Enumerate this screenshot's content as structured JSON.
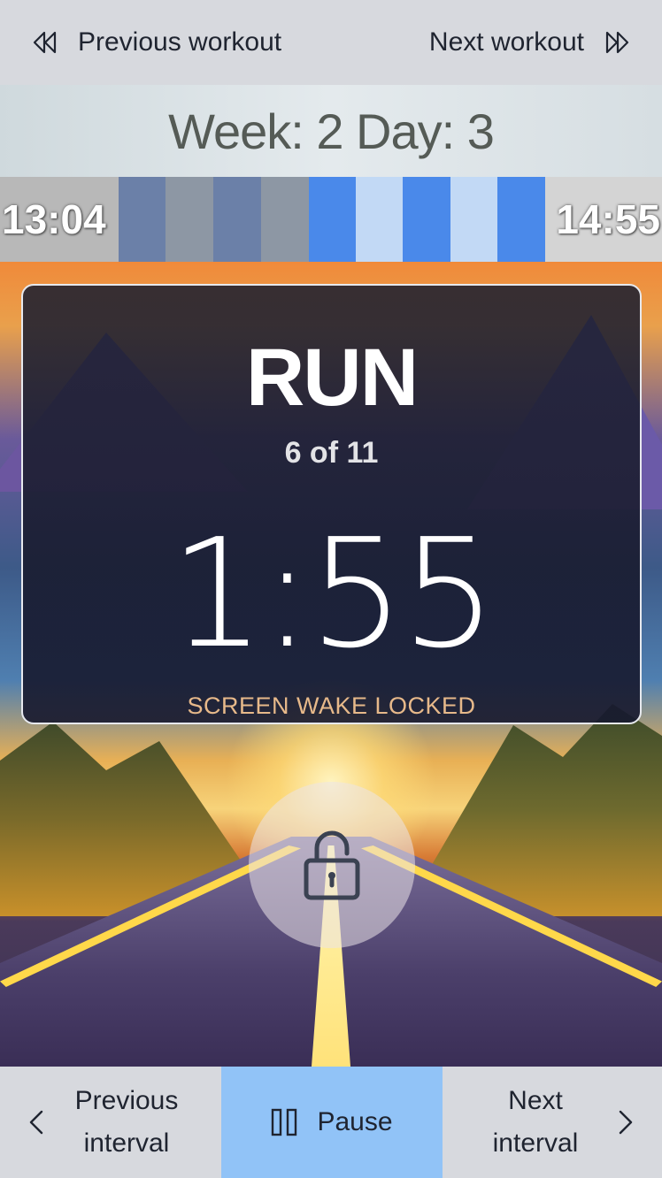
{
  "top_nav": {
    "previous_workout_label": "Previous workout",
    "next_workout_label": "Next workout",
    "icons": {
      "previous": "double-chevron-left-icon",
      "next": "double-chevron-right-icon"
    }
  },
  "week_header": {
    "text": "Week: 2 Day: 3"
  },
  "progress": {
    "elapsed_time": "13:04",
    "remaining_time": "14:55",
    "current_interval_index": 6,
    "total_intervals": 11
  },
  "interval": {
    "title": "RUN",
    "count_text": "6 of 11",
    "timer": "1:55",
    "wake_status": "SCREEN WAKE LOCKED"
  },
  "lock_button": {
    "icon": "unlock-icon"
  },
  "bottom_nav": {
    "previous_interval_line1": "Previous",
    "previous_interval_line2": "interval",
    "pause_label": "Pause",
    "next_interval_line1": "Next",
    "next_interval_line2": "interval",
    "icons": {
      "previous": "chevron-left-icon",
      "pause": "pause-icon",
      "next": "chevron-right-icon"
    }
  },
  "colors": {
    "nav_bg": "#d7d9de",
    "pause_bg": "#91c3f7",
    "completed_segment": "#6b80a8",
    "completed_segment_alt": "#8d97a4",
    "upcoming_run": "#4a89ea",
    "upcoming_walk": "#c2d9f5",
    "wake_text": "#e7b98a"
  }
}
